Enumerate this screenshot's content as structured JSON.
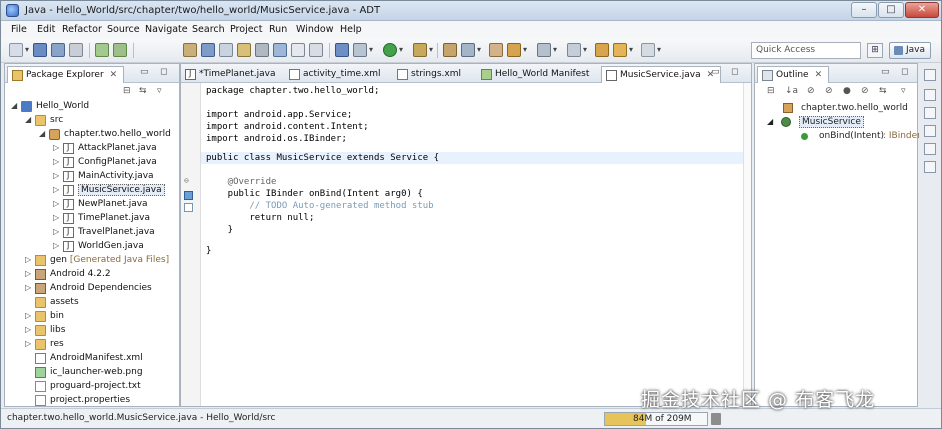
{
  "window": {
    "title": "Java - Hello_World/src/chapter/two/hello_world/MusicService.java - ADT"
  },
  "menu": [
    "File",
    "Edit",
    "Refactor",
    "Source",
    "Navigate",
    "Search",
    "Project",
    "Run",
    "Window",
    "Help"
  ],
  "toolbar": {
    "quick_access_placeholder": "Quick Access",
    "perspective": "Java"
  },
  "package_explorer": {
    "title": "Package Explorer",
    "tree": [
      {
        "label": "Hello_World",
        "icon": "project-icon"
      },
      {
        "label": "src",
        "icon": "source-folder-icon"
      },
      {
        "label": "chapter.two.hello_world",
        "icon": "package-icon"
      },
      {
        "label": "AttackPlanet.java",
        "icon": "java-file-icon"
      },
      {
        "label": "ConfigPlanet.java",
        "icon": "java-file-icon"
      },
      {
        "label": "MainActivity.java",
        "icon": "java-file-icon"
      },
      {
        "label": "MusicService.java",
        "icon": "java-file-icon"
      },
      {
        "label": "NewPlanet.java",
        "icon": "java-file-icon"
      },
      {
        "label": "TimePlanet.java",
        "icon": "java-file-icon"
      },
      {
        "label": "TravelPlanet.java",
        "icon": "java-file-icon"
      },
      {
        "label": "WorldGen.java",
        "icon": "java-file-icon"
      },
      {
        "label": "gen",
        "decoration": "[Generated Java Files]",
        "icon": "generated-folder-icon"
      },
      {
        "label": "Android 4.2.2",
        "icon": "library-icon"
      },
      {
        "label": "Android Dependencies",
        "icon": "library-icon"
      },
      {
        "label": "assets",
        "icon": "folder-icon"
      },
      {
        "label": "bin",
        "icon": "folder-icon"
      },
      {
        "label": "libs",
        "icon": "folder-icon"
      },
      {
        "label": "res",
        "icon": "folder-icon"
      },
      {
        "label": "AndroidManifest.xml",
        "icon": "xml-file-icon"
      },
      {
        "label": "ic_launcher-web.png",
        "icon": "image-file-icon"
      },
      {
        "label": "proguard-project.txt",
        "icon": "text-file-icon"
      },
      {
        "label": "project.properties",
        "icon": "text-file-icon"
      }
    ]
  },
  "editor": {
    "tabs": [
      "*TimePlanet.java",
      "activity_time.xml",
      "strings.xml",
      "Hello_World Manifest",
      "MusicService.java"
    ],
    "code": [
      "package chapter.two.hello_world;",
      "",
      "import android.app.Service;",
      "import android.content.Intent;",
      "import android.os.IBinder;",
      "",
      "public class MusicService extends Service {",
      "",
      "    @Override",
      "    public IBinder onBind(Intent arg0) {",
      "        // TODO Auto-generated method stub",
      "        return null;",
      "    }",
      "",
      "}"
    ]
  },
  "outline": {
    "title": "Outline",
    "items": [
      {
        "label": "chapter.two.hello_world"
      },
      {
        "label": "MusicService"
      },
      {
        "label": "onBind(Intent)",
        "type": ": IBinder"
      }
    ]
  },
  "status": {
    "selection": "chapter.two.hello_world.MusicService.java - Hello_World/src",
    "heap": "84M of 209M",
    "heap_fraction": 0.4
  },
  "watermark": "掘金技术社区 @ 布客飞龙"
}
